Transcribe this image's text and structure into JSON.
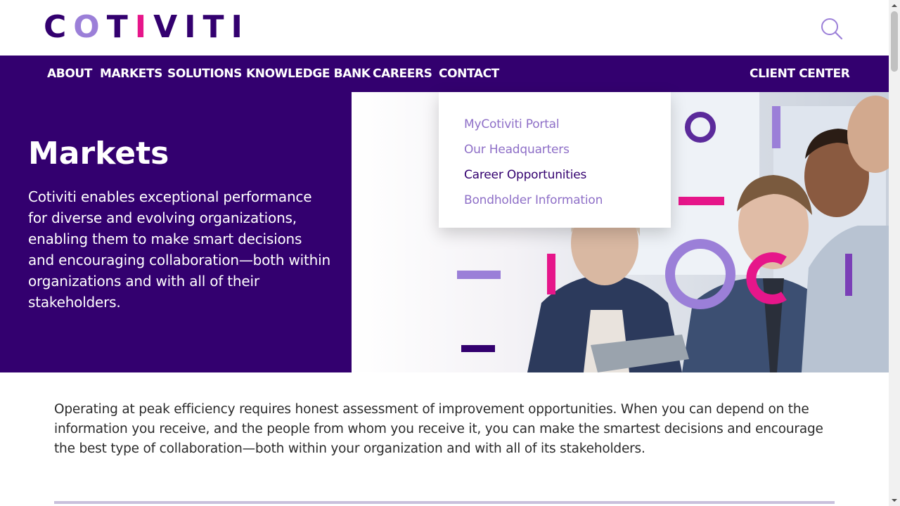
{
  "brand": {
    "letters": [
      "C",
      "O",
      "T",
      "I",
      "V",
      "I",
      "T",
      "I"
    ],
    "colors": {
      "purple_dark": "#33006f",
      "purple_light": "#9b7fd8",
      "magenta": "#e6168a",
      "lavender": "#8e6fc7"
    }
  },
  "header": {
    "search_icon": "search-icon"
  },
  "nav": {
    "items": [
      {
        "label": "ABOUT"
      },
      {
        "label": "MARKETS"
      },
      {
        "label": "SOLUTIONS"
      },
      {
        "label": "KNOWLEDGE BANK"
      },
      {
        "label": "CAREERS"
      },
      {
        "label": "CONTACT"
      }
    ],
    "client_center": "CLIENT CENTER"
  },
  "dropdown": {
    "items": [
      {
        "label": "MyCotiviti Portal"
      },
      {
        "label": "Our Headquarters"
      },
      {
        "label": "Career Opportunities"
      },
      {
        "label": "Bondholder Information"
      }
    ]
  },
  "hero": {
    "title": "Markets",
    "text": "Cotiviti enables exceptional performance for diverse and evolving organizations, enabling them to make smart decisions and encouraging collaboration—both within organizations and with all of their stakeholders."
  },
  "intro": {
    "text": "Operating at peak efficiency requires honest assessment of improvement opportunities. When you can depend on the information you receive, and the people from whom you receive it, you can make the smartest decisions and encourage the best type of collaboration—both within your organization and with all of its stakeholders."
  }
}
